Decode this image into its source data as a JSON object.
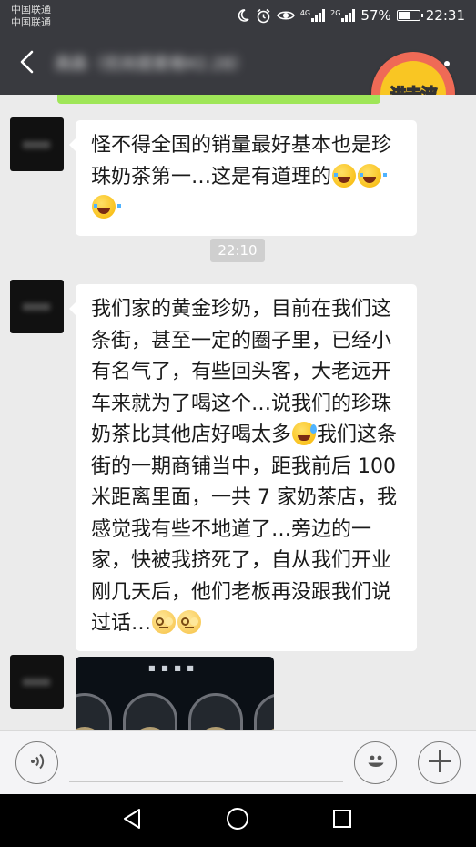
{
  "status_bar": {
    "carrier_line1": "中国联通",
    "carrier_line2": "中国联通",
    "network_1": "4G",
    "network_2": "2G",
    "battery_text": "57%",
    "battery_level": 0.57,
    "time": "22:31",
    "icons": [
      "moon-icon",
      "alarm-icon",
      "eye-icon",
      "signal-icon",
      "battery-icon"
    ]
  },
  "header": {
    "back_icon": "chevron-left-icon",
    "title": "高森（优尚提麦格¥2.28）",
    "menu_icon": "more-icon"
  },
  "watermark": {
    "text": "进击波"
  },
  "messages": [
    {
      "type": "text",
      "text": "怪不得全国的销量最好基本也是珍珠奶茶第一…这是有道理的",
      "emoji": [
        "laughing-tears-emoji",
        "laughing-tears-emoji",
        "laughing-tears-emoji"
      ]
    },
    {
      "type": "timestamp",
      "text": "22:10"
    },
    {
      "type": "text",
      "text_part1": "我们家的黄金珍奶，目前在我们这条街，甚至一定的圈子里，已经小有名气了，有些回头客，大老远开车来就为了喝这个…说我们的珍珠奶茶比其他店好喝太多",
      "text_part2": "我们这条街的一期商铺当中，距我前后 100 米距离里面，一共 7 家奶茶店，我感觉我有些不地道了…旁边的一家，快被我挤死了，自从我们开业刚几天后，他们老板再没跟我们说过话…",
      "emoji_mid": "sweat-laugh-emoji",
      "emoji_end": [
        "rolling-eyes-emoji",
        "rolling-eyes-emoji"
      ]
    },
    {
      "type": "image",
      "description": "storefront-photo"
    }
  ],
  "input_bar": {
    "voice_icon": "voice-icon",
    "placeholder": "",
    "emoji_icon": "smiley-icon",
    "plus_icon": "plus-icon"
  },
  "nav_bar": {
    "icons": [
      "back-triangle-icon",
      "home-circle-icon",
      "recent-square-icon"
    ]
  },
  "colors": {
    "header_bg": "#393a3f",
    "chat_bg": "#ebebeb",
    "bubble_bg": "#ffffff",
    "sent_bubble": "#9fe658",
    "badge_outer": "#ef6a56",
    "badge_inner": "#f9c623"
  }
}
